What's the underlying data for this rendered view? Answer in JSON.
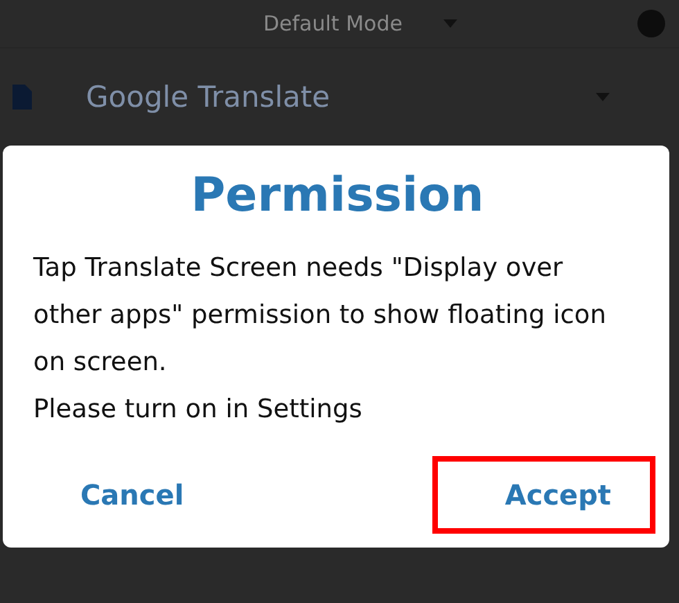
{
  "top_bar": {
    "mode": "Default Mode"
  },
  "app_row": {
    "name": "Google Translate"
  },
  "dialog": {
    "title": "Permission",
    "message": [
      "Tap Translate Screen needs \"Display over other apps\" permission to show floating icon on screen.",
      "Please turn on in Settings"
    ],
    "buttons": [
      {
        "label": "Cancel",
        "highlighted": false
      },
      {
        "label": "Accept",
        "highlighted": true
      }
    ]
  }
}
